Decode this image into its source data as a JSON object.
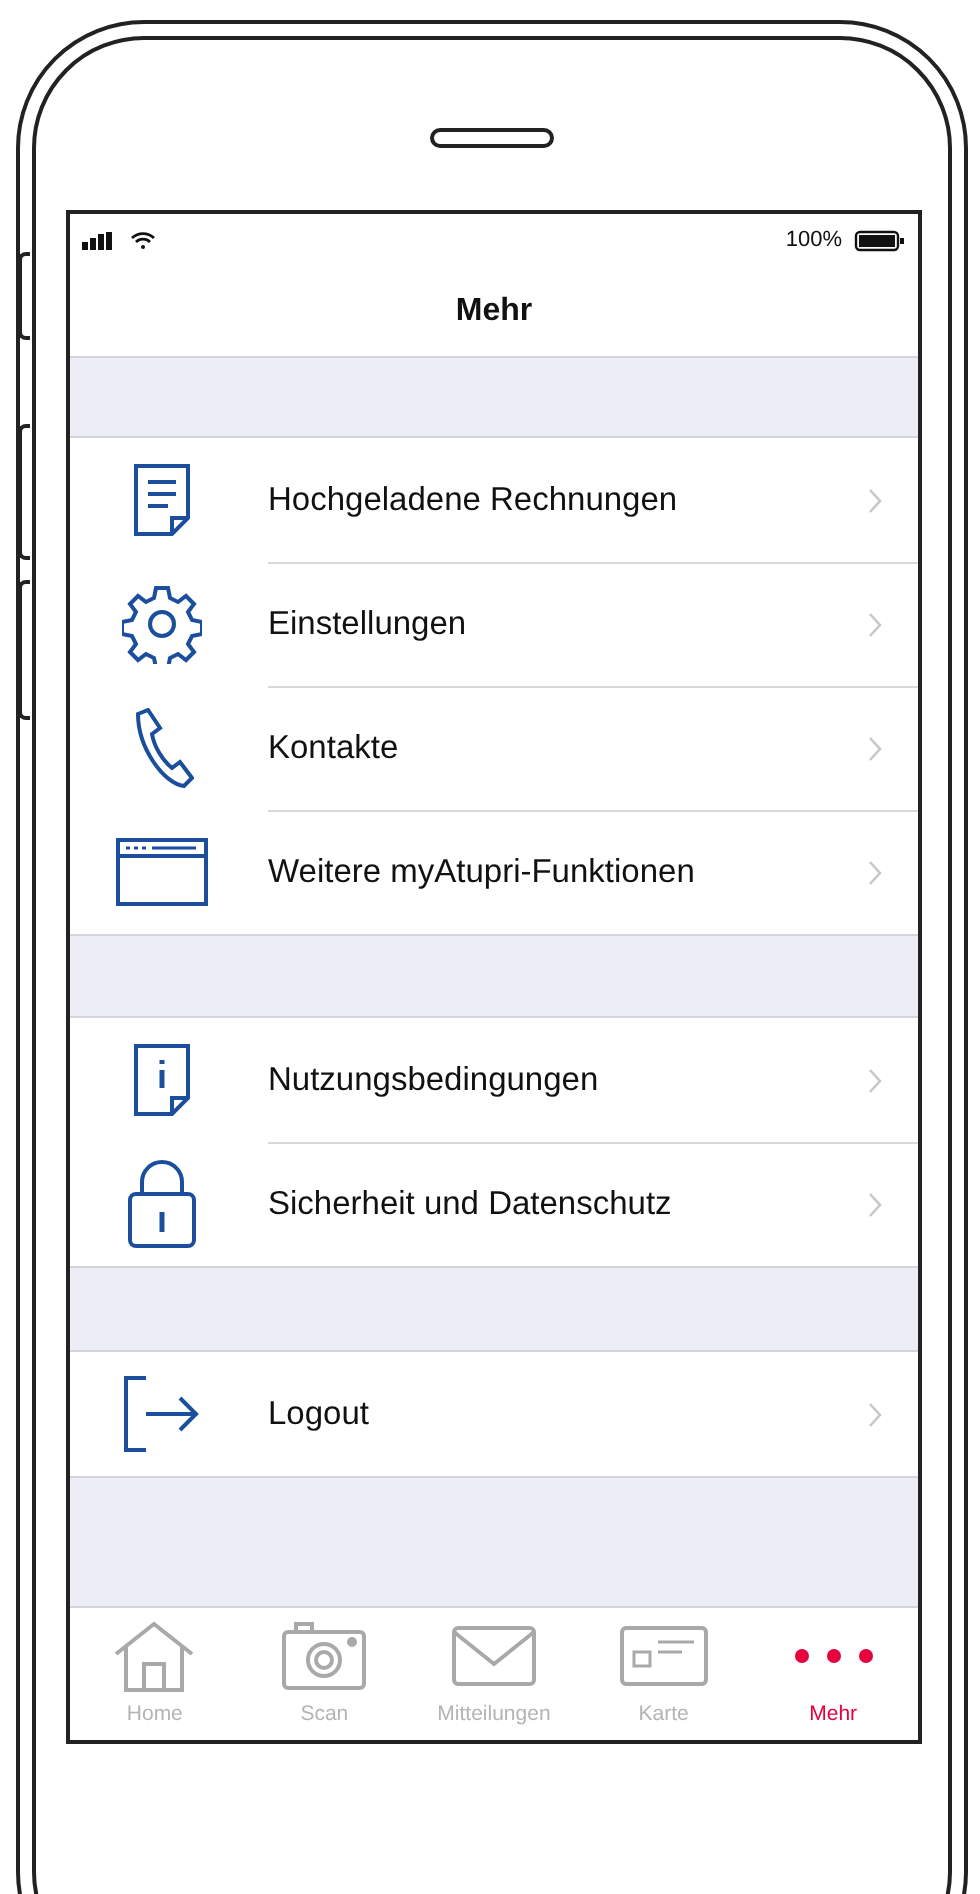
{
  "status_bar": {
    "battery": "100%"
  },
  "nav_bar": {
    "title": "Mehr"
  },
  "sections": [
    {
      "items": [
        {
          "kind": "document",
          "label": "Hochgeladene Rechnungen"
        },
        {
          "kind": "gear",
          "label": "Einstellungen"
        },
        {
          "kind": "phone",
          "label": "Kontakte"
        },
        {
          "kind": "browser",
          "label": "Weitere myAtupri-Funktionen"
        }
      ]
    },
    {
      "items": [
        {
          "kind": "info",
          "label": "Nutzungsbedingungen"
        },
        {
          "kind": "lock",
          "label": "Sicherheit und Datenschutz"
        }
      ]
    },
    {
      "items": [
        {
          "kind": "logout",
          "label": "Logout"
        }
      ]
    }
  ],
  "tab_bar": [
    {
      "kind": "home",
      "label": "Home",
      "selected": false
    },
    {
      "kind": "camera",
      "label": "Scan",
      "selected": false
    },
    {
      "kind": "mail",
      "label": "Mitteilungen",
      "selected": false
    },
    {
      "kind": "card",
      "label": "Karte",
      "selected": false
    },
    {
      "kind": "dots",
      "label": "Mehr",
      "selected": true
    }
  ]
}
